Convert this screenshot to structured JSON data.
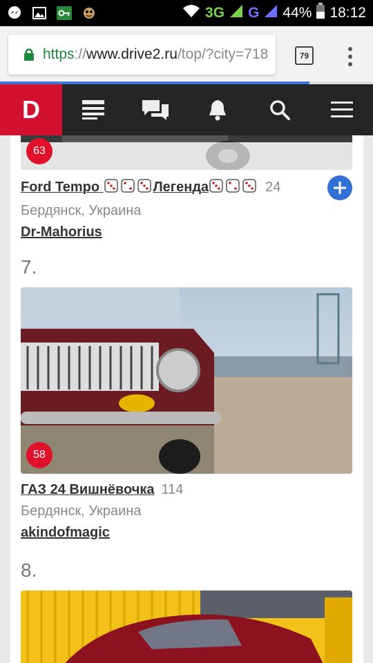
{
  "status_bar": {
    "network": "3G",
    "network2": "G",
    "battery": "44%",
    "time": "18:12"
  },
  "browser": {
    "url_scheme": "https",
    "url_sep": "://",
    "url_host": "www.drive2.ru",
    "url_path": "/top/?city=718",
    "tab_count": "79",
    "load_progress": 0.83
  },
  "site_nav": {
    "logo": "D",
    "items": [
      "feed-icon",
      "messages-icon",
      "notifications-icon",
      "search-icon",
      "menu-icon"
    ]
  },
  "entries": [
    {
      "rank": "",
      "title_a": "Ford Tempo ",
      "title_b": "Легенда",
      "count": "24",
      "location": "Бердянск, Украина",
      "owner": "Dr-Mahorius",
      "badge": "63"
    },
    {
      "rank": "7.",
      "title": "ГАЗ 24 Вишнёвочка",
      "count": "114",
      "location": "Бердянск, Украина",
      "owner": "akindofmagic",
      "badge": "58"
    },
    {
      "rank": "8."
    }
  ]
}
